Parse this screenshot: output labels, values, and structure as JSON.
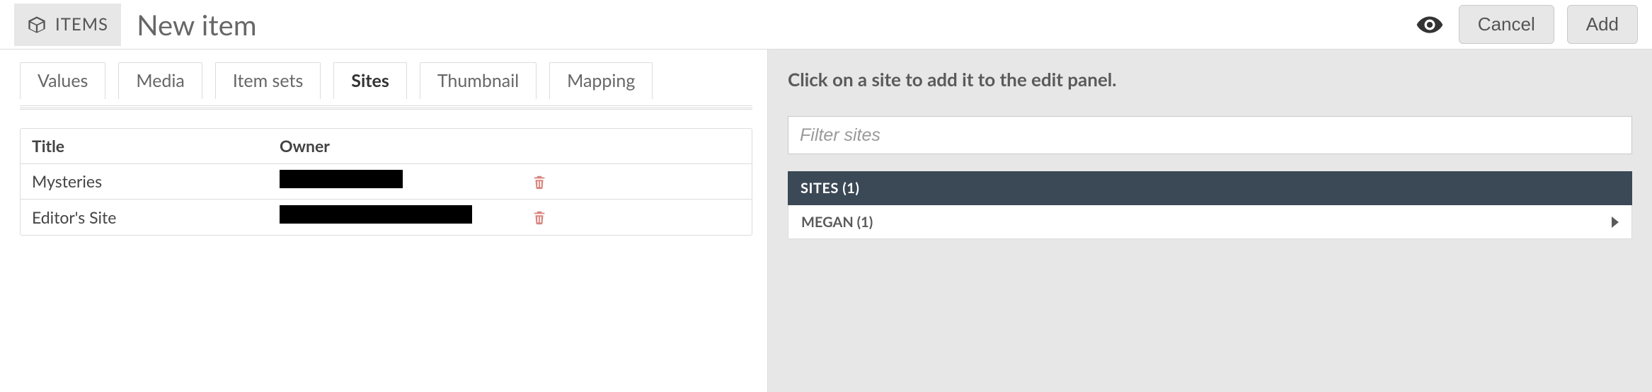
{
  "header": {
    "badge_label": "ITEMS",
    "page_title": "New item",
    "cancel_label": "Cancel",
    "add_label": "Add"
  },
  "tabs": [
    {
      "key": "values",
      "label": "Values",
      "active": false
    },
    {
      "key": "media",
      "label": "Media",
      "active": false
    },
    {
      "key": "itemsets",
      "label": "Item sets",
      "active": false
    },
    {
      "key": "sites",
      "label": "Sites",
      "active": true
    },
    {
      "key": "thumbnail",
      "label": "Thumbnail",
      "active": false
    },
    {
      "key": "mapping",
      "label": "Mapping",
      "active": false
    }
  ],
  "sites_table": {
    "columns": {
      "title": "Title",
      "owner": "Owner"
    },
    "rows": [
      {
        "title": "Mysteries",
        "owner_redacted": true,
        "redact_width": 174
      },
      {
        "title": "Editor's Site",
        "owner_redacted": true,
        "redact_width": 272
      }
    ]
  },
  "sidebar": {
    "instruction": "Click on a site to add it to the edit panel.",
    "filter_placeholder": "Filter sites",
    "group_header": "SITES (1)",
    "group_items": [
      {
        "label": "MEGAN (1)"
      }
    ]
  }
}
